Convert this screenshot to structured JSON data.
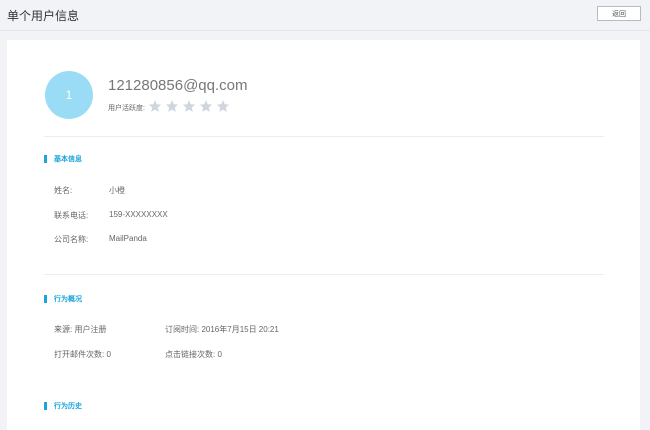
{
  "header": {
    "title": "单个用户信息",
    "back_label": "返回"
  },
  "profile": {
    "avatar_text": "1",
    "email": "121280856@qq.com",
    "activity_label": "用户活跃度:",
    "rating": {
      "value": 0,
      "max": 5
    },
    "star_color": "#cfd6df"
  },
  "basic_info": {
    "title": "基本信息",
    "fields": [
      {
        "label": "姓名:",
        "value": "小橙"
      },
      {
        "label": "联系电话:",
        "value": "159-XXXXXXXX"
      },
      {
        "label": "公司名称:",
        "value": "MailPanda"
      }
    ]
  },
  "behavior": {
    "title": "行为概况",
    "source": "来源: 用户注册",
    "subscribe_time": "订阅时间: 2016年7月15日 20:21",
    "open_count": "打开邮件次数: 0",
    "click_count": "点击链接次数: 0"
  },
  "history": {
    "title": "行为历史"
  },
  "colors": {
    "accent": "#1da4df",
    "avatar_bg": "#9adcf6"
  }
}
